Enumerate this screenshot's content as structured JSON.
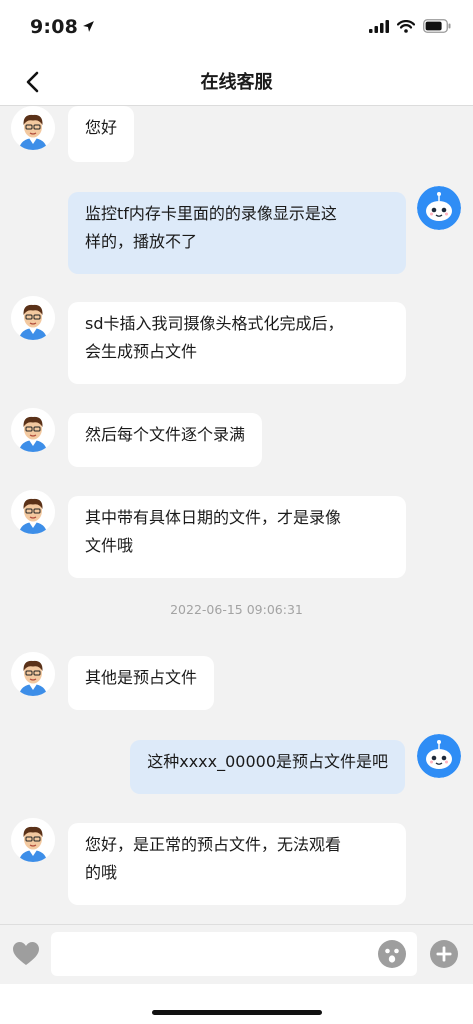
{
  "status_bar": {
    "time": "9:08",
    "location_icon": "location-arrow-icon",
    "signal_icon": "cellular-signal-icon",
    "wifi_icon": "wifi-icon",
    "battery_icon": "battery-icon"
  },
  "nav": {
    "back_icon": "chevron-left-icon",
    "title": "在线客服"
  },
  "messages": [
    {
      "sender": "agent",
      "lines": [
        "您好"
      ]
    },
    {
      "sender": "user",
      "lines": [
        "监控tf内存卡里面的的录像显示是这",
        "样的，播放不了"
      ]
    },
    {
      "sender": "agent",
      "lines": [
        "sd卡插入我司摄像头格式化完成后，",
        "会生成预占文件"
      ]
    },
    {
      "sender": "agent",
      "lines": [
        "然后每个文件逐个录满"
      ]
    },
    {
      "sender": "agent",
      "lines": [
        "其中带有具体日期的文件，才是录像",
        "文件哦"
      ]
    },
    {
      "sender": "agent",
      "lines": [
        "其他是预占文件"
      ]
    },
    {
      "sender": "user",
      "lines": [
        "这种xxxx_00000是预占文件是吧"
      ]
    },
    {
      "sender": "agent",
      "lines": [
        "您好，是正常的预占文件，无法观看",
        "的哦"
      ]
    }
  ],
  "timestamp": "2022-06-15 09:06:31",
  "input_bar": {
    "heart_icon": "heart-icon",
    "emoji_icon": "emoji-face-icon",
    "plus_icon": "plus-icon",
    "placeholder": ""
  },
  "colors": {
    "agent_bubble": "#ffffff",
    "user_bubble": "#ddeaf9",
    "background": "#f2f2f2",
    "robot_avatar": "#2f8df5"
  }
}
